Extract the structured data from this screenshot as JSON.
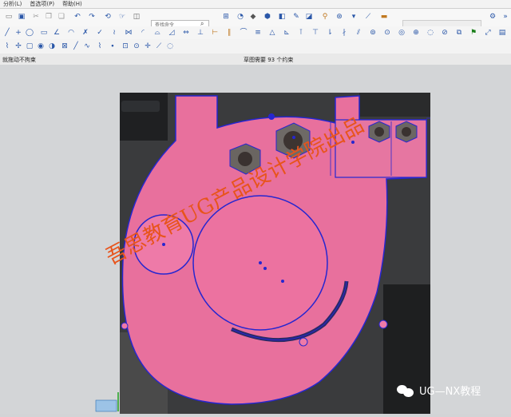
{
  "menu": {
    "items": [
      "分析(L)",
      "首选项(P)",
      "帮助(H)"
    ]
  },
  "toolbar": {
    "command_search_placeholder": "查找命令"
  },
  "status": {
    "left": "就拖动不拘束",
    "center": "草图需要 93 个约束"
  },
  "watermark": {
    "text": "吾思教育UG产品设计学院出品"
  },
  "branding": {
    "wechat_label": "UG—NX教程"
  },
  "colors": {
    "part_fill": "#e8709d",
    "sketch_lines": "#2626d0",
    "watermark": "#e8541b",
    "background": "#d3d5d7"
  },
  "icons": [
    "hide-icon",
    "undo-icon",
    "redo-icon",
    "snap-icon",
    "view-icon",
    "layer-icon",
    "sketch-icon",
    "measure-icon",
    "line-icon",
    "arc-icon",
    "circle-icon",
    "trim-icon",
    "dimension-icon",
    "constraint-icon"
  ]
}
